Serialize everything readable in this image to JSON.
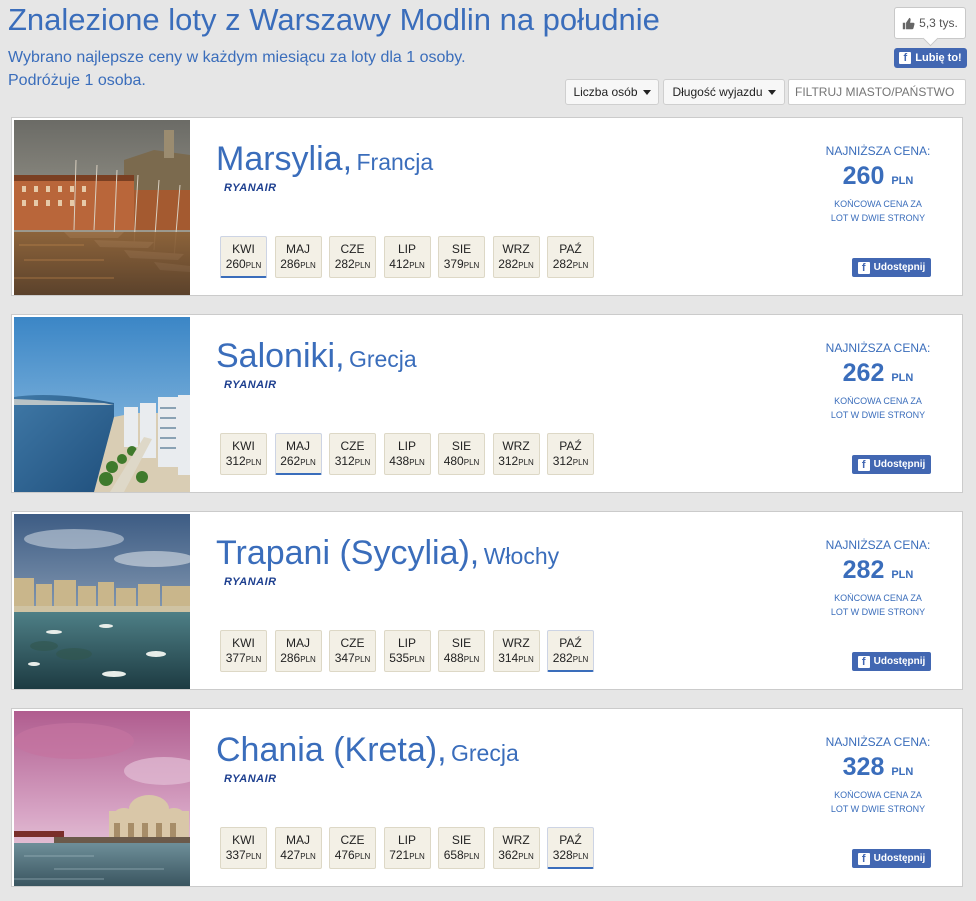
{
  "header": {
    "title": "Znalezione loty z Warszawy Modlin na południe",
    "subtitle_line1": "Wybrano najlepsze ceny w każdym miesiącu za loty dla 1 osoby.",
    "subtitle_line2": "Podróżuje 1 osoba."
  },
  "social": {
    "like_count": "5,3 tys.",
    "like_button": "Lubię to!"
  },
  "filters": {
    "persons_label": "Liczba osób",
    "duration_label": "Długość wyjazdu",
    "city_filter_placeholder": "FILTRUJ MIASTO/PAŃSTWO"
  },
  "price_texts": {
    "lowest_label": "NAJNIŻSZA CENA:",
    "currency": "PLN",
    "note_line1": "KOŃCOWA CENA ZA",
    "note_line2": "LOT W DWIE STRONY",
    "share_label": "Udostępnij"
  },
  "destinations": [
    {
      "city": "Marsylia,",
      "country": "Francja",
      "airline": "RYANAIR",
      "lowest_price": "260",
      "months": [
        {
          "name": "KWI",
          "price": "260",
          "selected": true
        },
        {
          "name": "MAJ",
          "price": "286",
          "selected": false
        },
        {
          "name": "CZE",
          "price": "282",
          "selected": false
        },
        {
          "name": "LIP",
          "price": "412",
          "selected": false
        },
        {
          "name": "SIE",
          "price": "379",
          "selected": false
        },
        {
          "name": "WRZ",
          "price": "282",
          "selected": false
        },
        {
          "name": "PAŹ",
          "price": "282",
          "selected": false
        }
      ]
    },
    {
      "city": "Saloniki,",
      "country": "Grecja",
      "airline": "RYANAIR",
      "lowest_price": "262",
      "months": [
        {
          "name": "KWI",
          "price": "312",
          "selected": false
        },
        {
          "name": "MAJ",
          "price": "262",
          "selected": true
        },
        {
          "name": "CZE",
          "price": "312",
          "selected": false
        },
        {
          "name": "LIP",
          "price": "438",
          "selected": false
        },
        {
          "name": "SIE",
          "price": "480",
          "selected": false
        },
        {
          "name": "WRZ",
          "price": "312",
          "selected": false
        },
        {
          "name": "PAŹ",
          "price": "312",
          "selected": false
        }
      ]
    },
    {
      "city": "Trapani (Sycylia),",
      "country": "Włochy",
      "airline": "RYANAIR",
      "lowest_price": "282",
      "months": [
        {
          "name": "KWI",
          "price": "377",
          "selected": false
        },
        {
          "name": "MAJ",
          "price": "286",
          "selected": false
        },
        {
          "name": "CZE",
          "price": "347",
          "selected": false
        },
        {
          "name": "LIP",
          "price": "535",
          "selected": false
        },
        {
          "name": "SIE",
          "price": "488",
          "selected": false
        },
        {
          "name": "WRZ",
          "price": "314",
          "selected": false
        },
        {
          "name": "PAŹ",
          "price": "282",
          "selected": true
        }
      ]
    },
    {
      "city": "Chania (Kreta),",
      "country": "Grecja",
      "airline": "RYANAIR",
      "lowest_price": "328",
      "months": [
        {
          "name": "KWI",
          "price": "337",
          "selected": false
        },
        {
          "name": "MAJ",
          "price": "427",
          "selected": false
        },
        {
          "name": "CZE",
          "price": "476",
          "selected": false
        },
        {
          "name": "LIP",
          "price": "721",
          "selected": false
        },
        {
          "name": "SIE",
          "price": "658",
          "selected": false
        },
        {
          "name": "WRZ",
          "price": "362",
          "selected": false
        },
        {
          "name": "PAŹ",
          "price": "328",
          "selected": true
        }
      ]
    }
  ]
}
